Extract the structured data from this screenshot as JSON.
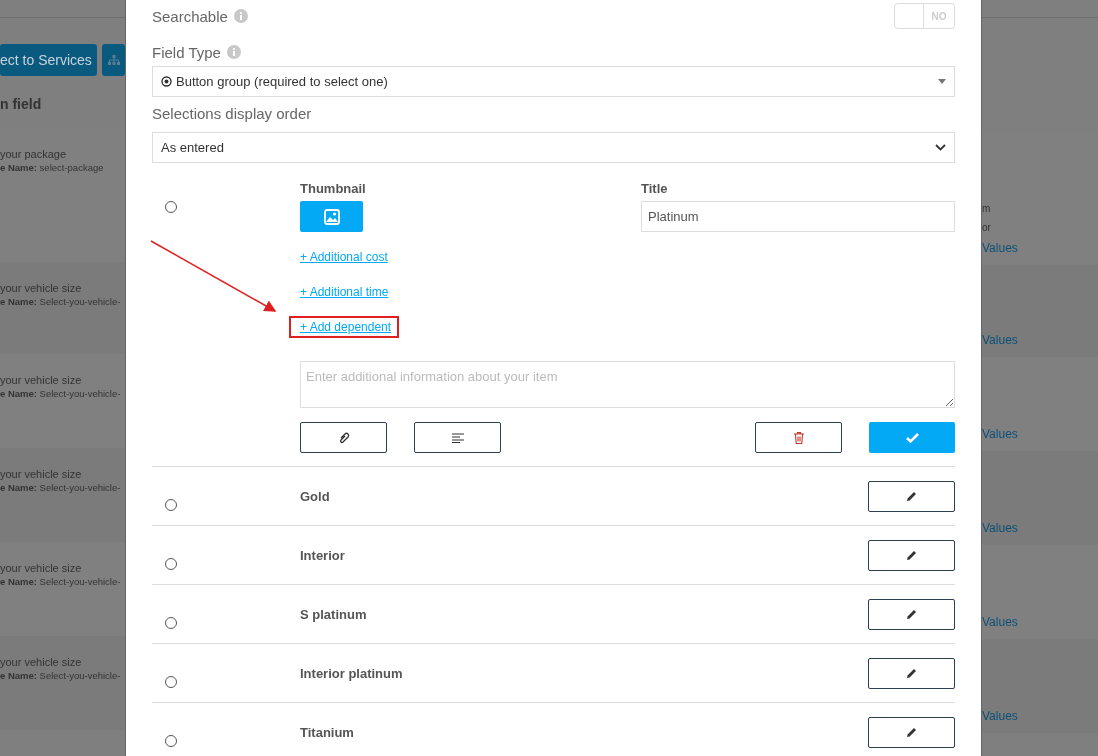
{
  "background": {
    "left": {
      "buttons": [
        "ect to Services"
      ],
      "column_heading": "n field",
      "rows": [
        {
          "label": "your package",
          "name_label": "e Name:",
          "name_value": "select-package"
        },
        {
          "label": "your vehicle size",
          "name_label": "e Name:",
          "name_value": "Select-you-vehicle-"
        },
        {
          "label": "your vehicle size",
          "name_label": "e Name:",
          "name_value": "Select-you-vehicle-"
        },
        {
          "label": "your vehicle size",
          "name_label": "e Name:",
          "name_value": "Select-you-vehicle-"
        },
        {
          "label": "your vehicle size",
          "name_label": "e Name:",
          "name_value": "Select-you-vehicle-"
        },
        {
          "label": "your vehicle size",
          "name_label": "e Name:",
          "name_value": "Select-you-vehicle-"
        }
      ]
    },
    "right": {
      "rows": [
        {
          "notes": [
            "m",
            "or"
          ],
          "link": "Values"
        },
        {
          "notes": [],
          "link": "Values"
        },
        {
          "notes": [],
          "link": "Values"
        },
        {
          "notes": [],
          "link": "Values"
        },
        {
          "notes": [],
          "link": "Values"
        },
        {
          "notes": [],
          "link": "Values"
        }
      ]
    }
  },
  "modal": {
    "searchable": {
      "label": "Searchable",
      "on": false,
      "toggle_text": "NO"
    },
    "field_type": {
      "label": "Field Type",
      "value": "Button group (required to select one)"
    },
    "display_order": {
      "label": "Selections display order",
      "value": "As entered"
    },
    "editing_item": {
      "selected": false,
      "thumbnail_label": "Thumbnail",
      "title_label": "Title",
      "title_value": "Platinum",
      "links": [
        {
          "text": "+ Additional cost",
          "highlighted": false
        },
        {
          "text": "+ Additional time",
          "highlighted": false
        },
        {
          "text": "+ Add dependent",
          "highlighted": true
        }
      ],
      "description_placeholder": "Enter additional information about your item"
    },
    "items": [
      {
        "title": "Gold",
        "selected": false
      },
      {
        "title": "Interior",
        "selected": false
      },
      {
        "title": "S platinum",
        "selected": false
      },
      {
        "title": "Interior platinum",
        "selected": false
      },
      {
        "title": "Titanium",
        "selected": false
      }
    ]
  }
}
